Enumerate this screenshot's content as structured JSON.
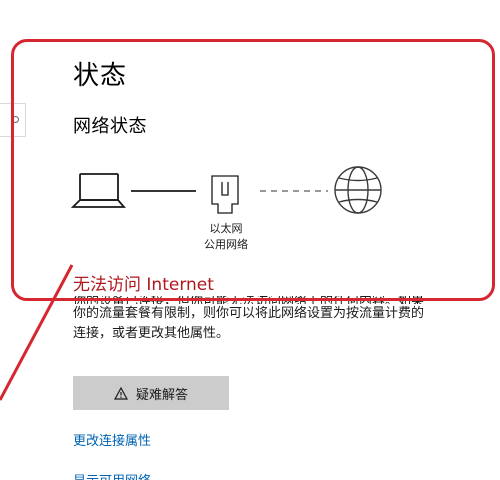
{
  "status": {
    "page_title": "状态",
    "section_title": "网络状态",
    "adapter_label_line1": "以太网",
    "adapter_label_line2": "公用网络",
    "connection_message": "无法访问 Internet",
    "description": {
      "line1": "你的设备已连接，但你可能无法访问网络上的任何内容。如果",
      "line2": "你的流量套餐有限制，则你可以将此网络设置为按流量计费的",
      "line3": "连接，或者更改其他属性。"
    }
  },
  "actions": {
    "troubleshoot_label": "疑难解答",
    "change_adapter_label": "更改连接属性",
    "show_networks_label": "显示可用网络"
  },
  "icons": {
    "computer": "laptop-icon",
    "adapter": "ethernet-adapter-icon",
    "internet": "globe-icon",
    "warning": "warning-icon"
  },
  "colors": {
    "error_text": "#b0171f",
    "link": "#0063b1",
    "button_bg": "#cccccc",
    "annotation": "#d6262f"
  }
}
